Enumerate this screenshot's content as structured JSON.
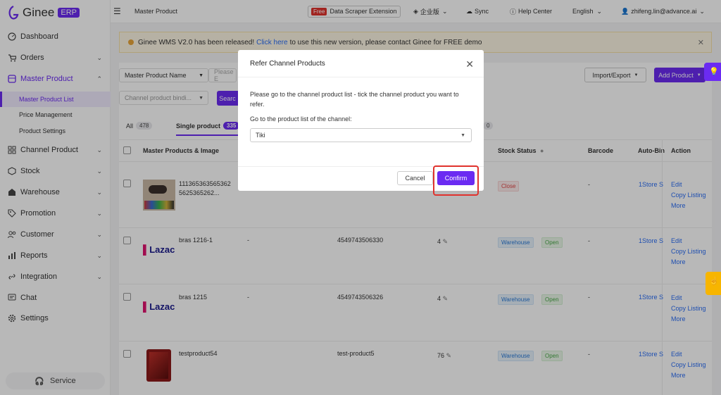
{
  "app": {
    "logo_text": "Ginee",
    "badge": "ERP"
  },
  "sidebar": {
    "items": [
      {
        "label": "Dashboard",
        "icon": "dashboard-icon",
        "chevron": false
      },
      {
        "label": "Orders",
        "icon": "cart-icon",
        "chevron": true
      },
      {
        "label": "Master Product",
        "icon": "box-icon",
        "chevron": true,
        "active": true
      },
      {
        "label": "Channel Product",
        "icon": "channel-icon",
        "chevron": true
      },
      {
        "label": "Stock",
        "icon": "cube-icon",
        "chevron": true
      },
      {
        "label": "Warehouse",
        "icon": "warehouse-icon",
        "chevron": true
      },
      {
        "label": "Promotion",
        "icon": "tag-icon",
        "chevron": true
      },
      {
        "label": "Customer",
        "icon": "users-icon",
        "chevron": true
      },
      {
        "label": "Reports",
        "icon": "chart-icon",
        "chevron": true
      },
      {
        "label": "Integration",
        "icon": "link-icon",
        "chevron": true
      },
      {
        "label": "Chat",
        "icon": "chat-icon",
        "chevron": false
      },
      {
        "label": "Settings",
        "icon": "gear-icon",
        "chevron": false
      }
    ],
    "subitems": [
      "Master Product List",
      "Price Management",
      "Product Settings"
    ],
    "service": "Service"
  },
  "topbar": {
    "page_title": "Master Product",
    "free_badge": "Free",
    "scraper": "Data Scraper Extension",
    "enterprise": "企业版",
    "sync": "Sync",
    "help": "Help Center",
    "language": "English",
    "user": "zhifeng.lin@advance.ai"
  },
  "banner": {
    "before": "Ginee WMS V2.0 has been released!",
    "link": "Click here",
    "after": "to use this new version, please contact Ginee for FREE demo"
  },
  "filters": {
    "search_type": "Master Product Name",
    "search_placeholder": "Please E",
    "binding": "Channel product bindi...",
    "search_btn": "Searc",
    "import_export": "Import/Export",
    "add_product": "Add Product"
  },
  "tabs": [
    {
      "label": "All",
      "count": "478"
    },
    {
      "label": "Single product",
      "count": "335"
    },
    {
      "label": "",
      "count": "0"
    }
  ],
  "table": {
    "headers": [
      "Master Products & Image",
      "Stock Status",
      "Barcode",
      "Auto-Bin",
      "Action"
    ],
    "rows": [
      {
        "name": "1113653635653625625365262...",
        "sku": "",
        "code": "",
        "stock": "",
        "tags": [
          "Close"
        ],
        "barcode": "-",
        "autobind": "1Store S",
        "image": "shoes"
      },
      {
        "name": "bras 1216-1",
        "sku": "-",
        "code": "4549743506330",
        "stock": "4",
        "tags": [
          "Warehouse",
          "Open"
        ],
        "barcode": "-",
        "autobind": "1Store S",
        "image": "Lazac"
      },
      {
        "name": "bras 1215",
        "sku": "-",
        "code": "4549743506326",
        "stock": "4",
        "tags": [
          "Warehouse",
          "Open"
        ],
        "barcode": "-",
        "autobind": "1Store S",
        "image": "Lazac"
      },
      {
        "name": "testproduct54",
        "sku": "",
        "code": "test-product5",
        "stock": "76",
        "tags": [
          "Warehouse",
          "Open"
        ],
        "barcode": "-",
        "autobind": "1Store S",
        "image": "phone"
      }
    ],
    "actions": [
      "Edit",
      "Copy Listing",
      "More"
    ]
  },
  "modal": {
    "title": "Refer Channel Products",
    "message": "Please go to the channel product list - tick the channel product you want to refer.",
    "label": "Go to the product list of the channel:",
    "selected": "Tiki",
    "cancel": "Cancel",
    "confirm": "Confirm"
  },
  "colors": {
    "accent": "#6b2bf2",
    "highlight": "#e0322d",
    "link": "#2a6df4"
  }
}
